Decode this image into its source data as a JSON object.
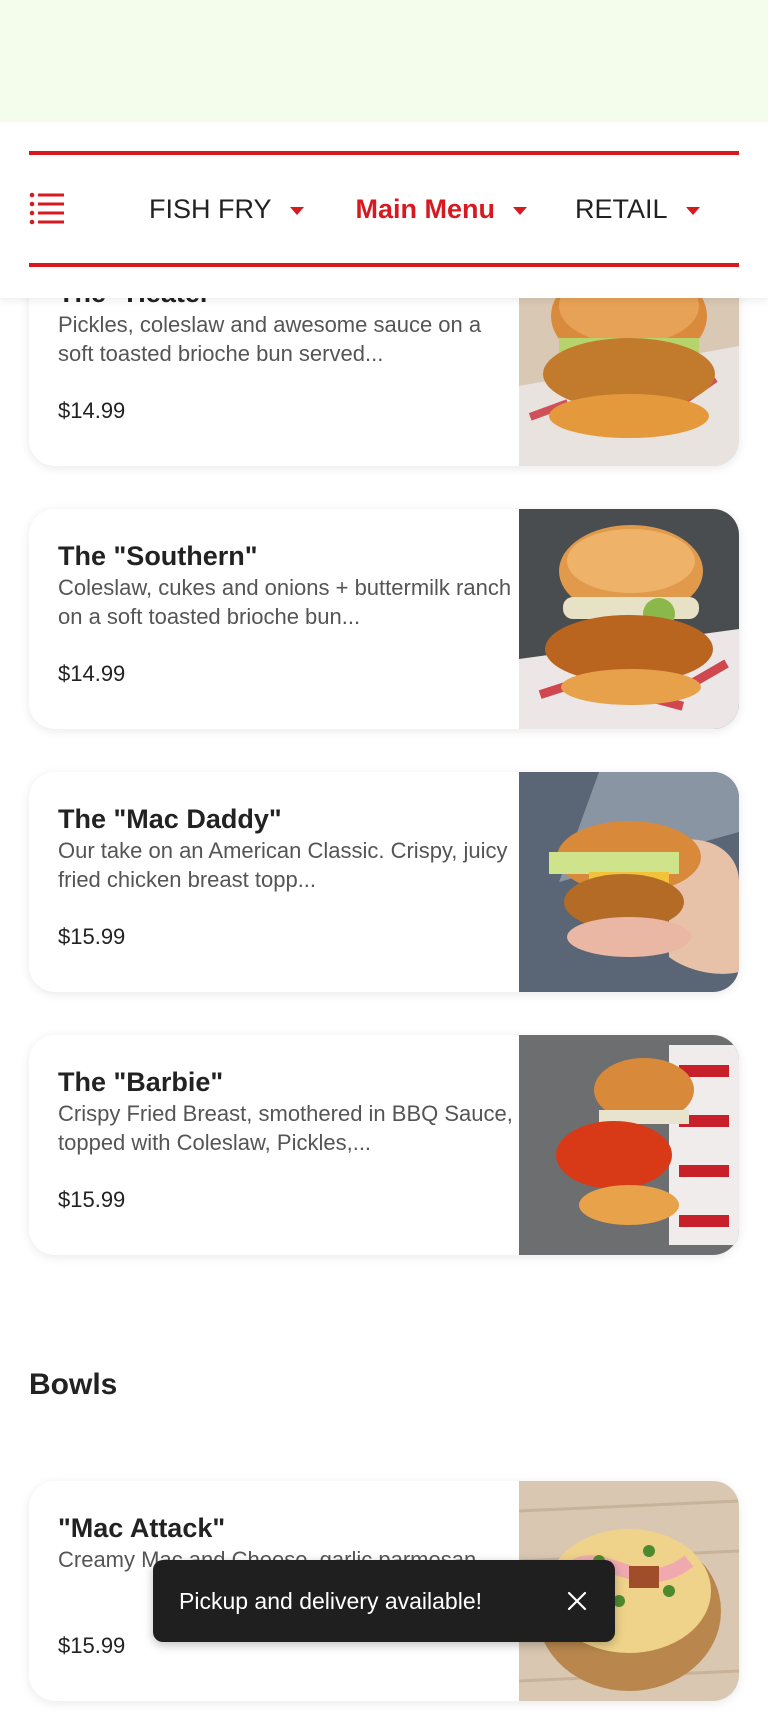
{
  "nav": {
    "items": [
      {
        "label": "FISH FRY",
        "active": false
      },
      {
        "label": "Main Menu",
        "active": true
      },
      {
        "label": "RETAIL",
        "active": false
      }
    ],
    "accent_color": "#d71920",
    "menu_icon": "list-icon",
    "caret_icon": "caret-down-icon"
  },
  "items": [
    {
      "name": "The \"Heater\"",
      "desc": "Pickles, coleslaw and awesome sauce on a soft toasted brioche bun served...",
      "price": "$14.99"
    },
    {
      "name": "The \"Southern\"",
      "desc": "Coleslaw, cukes and onions + buttermilk ranch on a soft toasted brioche bun...",
      "price": "$14.99"
    },
    {
      "name": "The \"Mac Daddy\"",
      "desc": "Our take on an American Classic. Crispy, juicy fried chicken breast topp...",
      "price": "$15.99"
    },
    {
      "name": "The \"Barbie\"",
      "desc": "Crispy Fried Breast, smothered in BBQ Sauce, topped with Coleslaw, Pickles,...",
      "price": "$15.99"
    }
  ],
  "bowls": {
    "title": "Bowls",
    "items": [
      {
        "name": "\"Mac Attack\"",
        "desc": "Creamy Mac and Cheese, garlic parmesan...",
        "price": "$15.99"
      }
    ]
  },
  "toast": {
    "text": "Pickup and delivery available!",
    "close_icon": "close-icon"
  }
}
